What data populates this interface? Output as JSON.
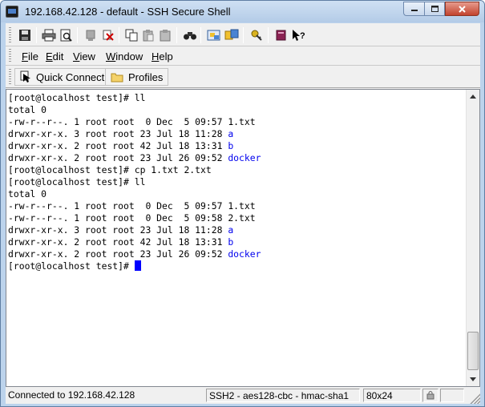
{
  "window": {
    "title": "192.168.42.128 - default - SSH Secure Shell",
    "buttons": [
      "minimize",
      "maximize",
      "close"
    ]
  },
  "toolbar": {
    "icons": [
      "save-icon",
      "print-icon",
      "print-preview-icon",
      "disconnect-icon",
      "cut-icon",
      "copy-icon",
      "paste-icon",
      "paste-clipboard-icon",
      "find-icon",
      "settings-icon",
      "file-transfer-icon",
      "keys-icon",
      "help-book-icon",
      "context-help-icon"
    ]
  },
  "menu": {
    "items": [
      {
        "label": "File",
        "accel": "F",
        "rest": "ile"
      },
      {
        "label": "Edit",
        "accel": "E",
        "rest": "dit"
      },
      {
        "label": "View",
        "accel": "V",
        "rest": "iew"
      },
      {
        "label": "Window",
        "accel": "W",
        "rest": "indow"
      },
      {
        "label": "Help",
        "accel": "H",
        "rest": "elp"
      }
    ]
  },
  "links": {
    "quick_connect": "Quick Connect",
    "profiles": "Profiles"
  },
  "terminal": {
    "lines": [
      {
        "text": "[root@localhost test]# ll"
      },
      {
        "text": "total 0"
      },
      {
        "text": "-rw-r--r--. 1 root root  0 Dec  5 09:57 ",
        "suffix": "1.txt"
      },
      {
        "text": "drwxr-xr-x. 3 root root 23 Jul 18 11:28 ",
        "suffix": "a",
        "blue": true
      },
      {
        "text": "drwxr-xr-x. 2 root root 42 Jul 18 13:31 ",
        "suffix": "b",
        "blue": true
      },
      {
        "text": "drwxr-xr-x. 2 root root 23 Jul 26 09:52 ",
        "suffix": "docker",
        "blue": true
      },
      {
        "text": "[root@localhost test]# cp 1.txt 2.txt"
      },
      {
        "text": "[root@localhost test]# ll"
      },
      {
        "text": "total 0"
      },
      {
        "text": "-rw-r--r--. 1 root root  0 Dec  5 09:57 ",
        "suffix": "1.txt"
      },
      {
        "text": "-rw-r--r--. 1 root root  0 Dec  5 09:58 ",
        "suffix": "2.txt"
      },
      {
        "text": "drwxr-xr-x. 3 root root 23 Jul 18 11:28 ",
        "suffix": "a",
        "blue": true
      },
      {
        "text": "drwxr-xr-x. 2 root root 42 Jul 18 13:31 ",
        "suffix": "b",
        "blue": true
      },
      {
        "text": "drwxr-xr-x. 2 root root 23 Jul 26 09:52 ",
        "suffix": "docker",
        "blue": true
      },
      {
        "text": "[root@localhost test]# ",
        "cursor": true
      }
    ]
  },
  "status": {
    "connection": "Connected to 192.168.42.128",
    "cipher": "SSH2 - aes128-cbc - hmac-sha1",
    "size": "80x24"
  },
  "colors": {
    "title_bg": "#bcd3ec",
    "dir_blue": "#0000ee",
    "cursor_blue": "#0000ff"
  }
}
